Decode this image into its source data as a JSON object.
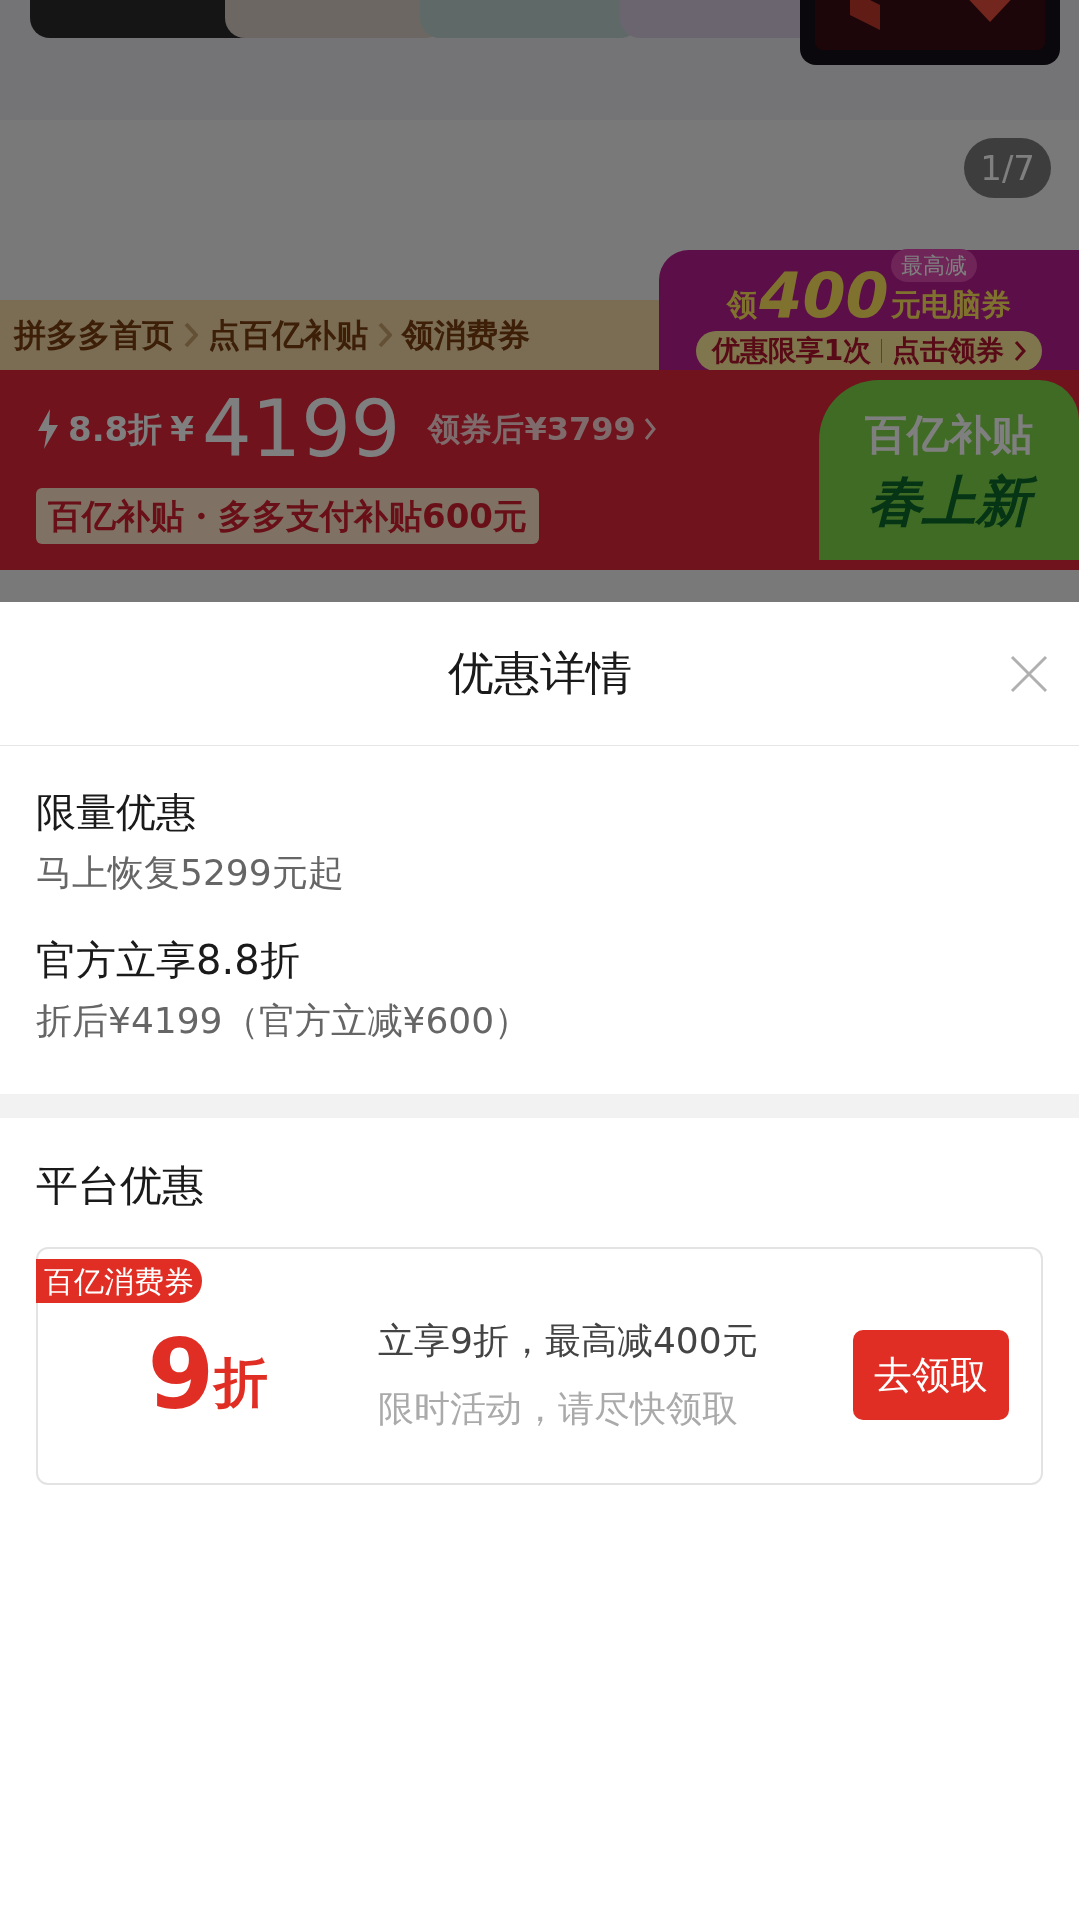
{
  "gallery": {
    "page_indicator": "1/7"
  },
  "promo_banner": {
    "prefix": "领",
    "amount": "400",
    "badge": "最高减",
    "suffix": "元电脑券",
    "limit": "优惠限享1次",
    "action": "点击领券"
  },
  "steps": [
    "拼多多首页",
    "点百亿补贴",
    "领消费券"
  ],
  "price_band": {
    "discount": "8.8折",
    "currency": "¥",
    "price": "4199",
    "coupon_price": "领券后¥3799",
    "subsidy": "百亿补贴・多多支付补贴600元",
    "badge_line1": "百亿补贴",
    "badge_line2": "春上新"
  },
  "sheet": {
    "title": "优惠详情",
    "offers": [
      {
        "title": "限量优惠",
        "detail": "马上恢复5299元起"
      },
      {
        "title": "官方立享8.8折",
        "detail": "折后¥4199（官方立减¥600）"
      }
    ],
    "platform_section": {
      "title": "平台优惠",
      "coupon": {
        "tag": "百亿消费券",
        "value": "9",
        "unit": "折",
        "headline": "立享9折，最高减400元",
        "note": "限时活动，请尽快领取",
        "button": "去领取"
      }
    }
  }
}
